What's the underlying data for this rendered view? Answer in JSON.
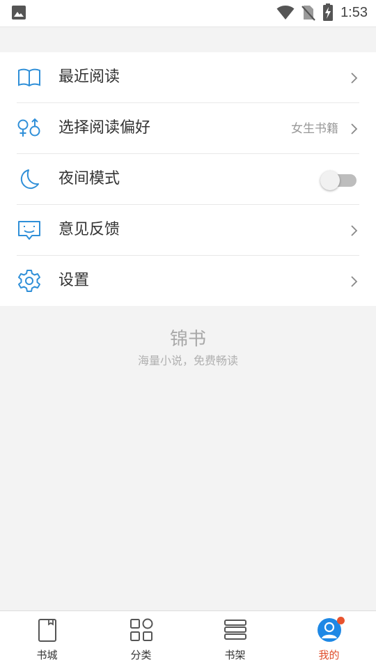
{
  "status_bar": {
    "time": "1:53",
    "icons": [
      "image-icon",
      "wifi-icon",
      "no-sim-icon",
      "battery-charging-icon"
    ]
  },
  "menu": {
    "items": [
      {
        "icon": "open-book-icon",
        "label": "最近阅读",
        "value": "",
        "control": "chevron"
      },
      {
        "icon": "gender-icon",
        "label": "选择阅读偏好",
        "value": "女生书籍",
        "control": "chevron"
      },
      {
        "icon": "moon-icon",
        "label": "夜间模式",
        "value": "",
        "control": "toggle",
        "toggle_on": false
      },
      {
        "icon": "feedback-icon",
        "label": "意见反馈",
        "value": "",
        "control": "chevron"
      },
      {
        "icon": "gear-icon",
        "label": "设置",
        "value": "",
        "control": "chevron"
      }
    ]
  },
  "brand": {
    "name": "锦书",
    "slogan": "海量小说，免费畅读"
  },
  "tab_bar": {
    "tabs": [
      {
        "icon": "bookstore-icon",
        "label": "书城",
        "active": false
      },
      {
        "icon": "category-icon",
        "label": "分类",
        "active": false
      },
      {
        "icon": "bookshelf-icon",
        "label": "书架",
        "active": false
      },
      {
        "icon": "profile-icon",
        "label": "我的",
        "active": true,
        "badge": true
      }
    ]
  },
  "colors": {
    "accent_blue": "#2f8fd8",
    "active_tab": "#e04e2c",
    "badge": "#e8532e",
    "page_bg": "#f3f3f3"
  }
}
